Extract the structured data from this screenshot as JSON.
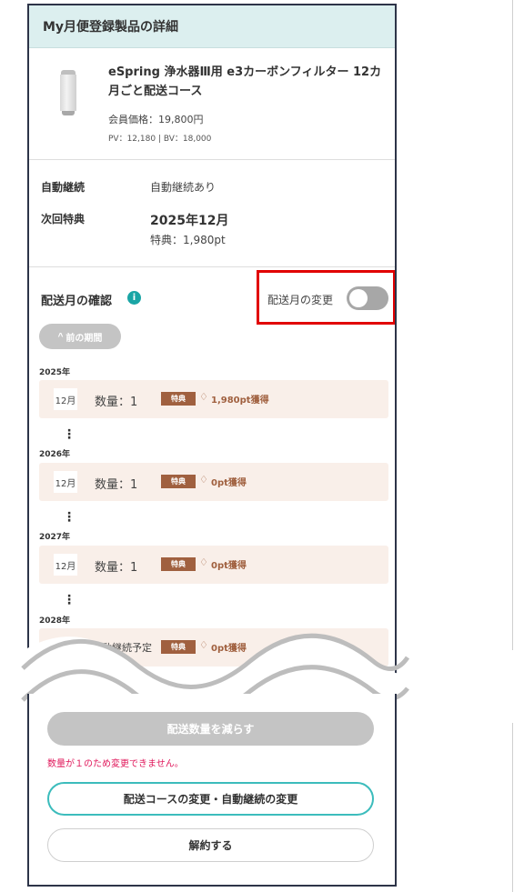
{
  "header": {
    "title": "My月便登録製品の詳細"
  },
  "product": {
    "name": "eSpring 浄水器Ⅲ用 e3カーボンフィルター 12カ月ごと配送コース",
    "price": "会員価格：19,800円",
    "pv_bv": "PV：12,180 | BV：18,000",
    "image_icon": "water-filter-cartridge"
  },
  "renewal": {
    "auto_label": "自動継続",
    "auto_value": "自動継続あり",
    "next_label": "次回特典",
    "next_date": "2025年12月",
    "next_points": "特典：1,980pt"
  },
  "delivery": {
    "title": "配送月の確認",
    "info_icon_glyph": "i",
    "toggle_label": "配送月の変更",
    "toggle_on": false,
    "prev_button": "前の期間",
    "prev_chevron": "^",
    "years": [
      {
        "year": "2025年",
        "month": "12月",
        "qty": "数量：1",
        "badge": "特典",
        "points": "1,980pt獲得"
      },
      {
        "year": "2026年",
        "month": "12月",
        "qty": "数量：1",
        "badge": "特典",
        "points": "0pt獲得"
      },
      {
        "year": "2027年",
        "month": "12月",
        "qty": "数量：1",
        "badge": "特典",
        "points": "0pt獲得"
      },
      {
        "year": "2028年",
        "month": "",
        "qty": "自動継続予定",
        "badge": "特典",
        "points": "0pt獲得"
      }
    ],
    "dots": "⋮",
    "tag_glyph": "♢"
  },
  "actions": {
    "reduce_label": "配送数量を減らす",
    "reduce_note": "数量が１のため変更できません。",
    "course_label": "配送コースの変更・自動継続の変更",
    "cancel_label": "解約する"
  },
  "colors": {
    "accent_teal": "#3cbcbc",
    "header_bg": "#dcefef",
    "badge_brown": "#a0603f",
    "row_bg": "#f9efe9",
    "highlight_red": "#e10000",
    "warning_pink": "#e0185b"
  }
}
